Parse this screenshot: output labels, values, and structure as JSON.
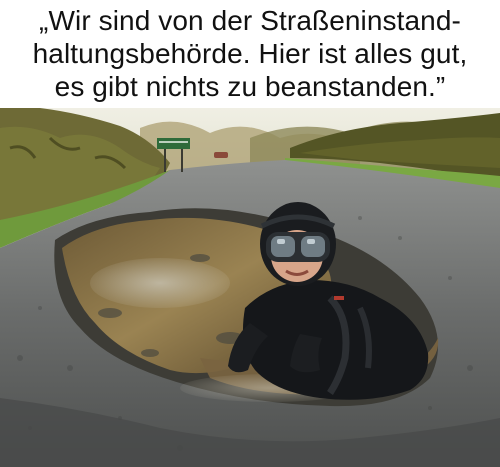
{
  "meme": {
    "caption_lines": [
      "„Wir sind von der Straßeninstand-",
      "haltungsbehörde. Hier ist alles gut,",
      "es gibt nichts zu beanstanden.”"
    ]
  },
  "photo": {
    "subject": "person-in-diving-gear-sitting-in-pothole",
    "colors": {
      "sky": "#e7e6d6",
      "asphalt": "#5f6160",
      "puddle": "#8a7146",
      "verge_green": "#6f9a3c",
      "wetsuit": "#151719"
    }
  }
}
